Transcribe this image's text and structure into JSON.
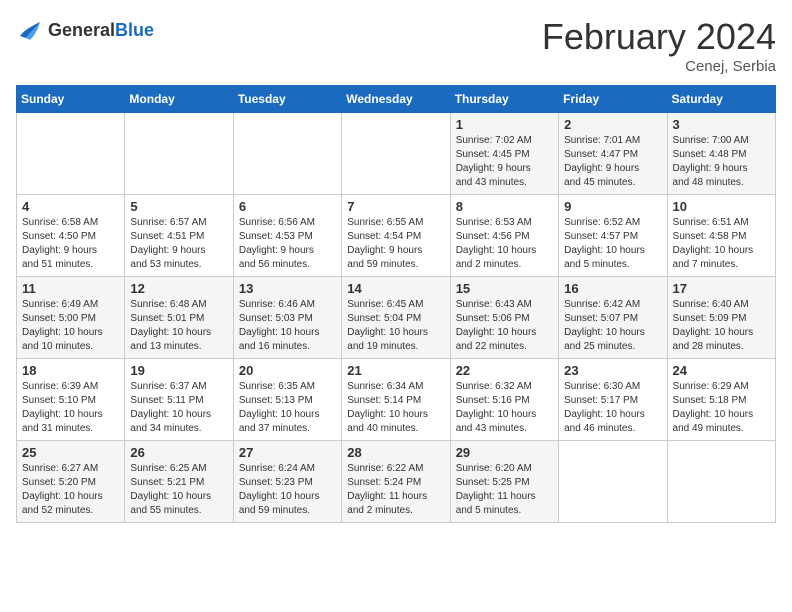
{
  "header": {
    "logo_general": "General",
    "logo_blue": "Blue",
    "title": "February 2024",
    "location": "Cenej, Serbia"
  },
  "weekdays": [
    "Sunday",
    "Monday",
    "Tuesday",
    "Wednesday",
    "Thursday",
    "Friday",
    "Saturday"
  ],
  "weeks": [
    [
      {
        "day": "",
        "info": ""
      },
      {
        "day": "",
        "info": ""
      },
      {
        "day": "",
        "info": ""
      },
      {
        "day": "",
        "info": ""
      },
      {
        "day": "1",
        "info": "Sunrise: 7:02 AM\nSunset: 4:45 PM\nDaylight: 9 hours\nand 43 minutes."
      },
      {
        "day": "2",
        "info": "Sunrise: 7:01 AM\nSunset: 4:47 PM\nDaylight: 9 hours\nand 45 minutes."
      },
      {
        "day": "3",
        "info": "Sunrise: 7:00 AM\nSunset: 4:48 PM\nDaylight: 9 hours\nand 48 minutes."
      }
    ],
    [
      {
        "day": "4",
        "info": "Sunrise: 6:58 AM\nSunset: 4:50 PM\nDaylight: 9 hours\nand 51 minutes."
      },
      {
        "day": "5",
        "info": "Sunrise: 6:57 AM\nSunset: 4:51 PM\nDaylight: 9 hours\nand 53 minutes."
      },
      {
        "day": "6",
        "info": "Sunrise: 6:56 AM\nSunset: 4:53 PM\nDaylight: 9 hours\nand 56 minutes."
      },
      {
        "day": "7",
        "info": "Sunrise: 6:55 AM\nSunset: 4:54 PM\nDaylight: 9 hours\nand 59 minutes."
      },
      {
        "day": "8",
        "info": "Sunrise: 6:53 AM\nSunset: 4:56 PM\nDaylight: 10 hours\nand 2 minutes."
      },
      {
        "day": "9",
        "info": "Sunrise: 6:52 AM\nSunset: 4:57 PM\nDaylight: 10 hours\nand 5 minutes."
      },
      {
        "day": "10",
        "info": "Sunrise: 6:51 AM\nSunset: 4:58 PM\nDaylight: 10 hours\nand 7 minutes."
      }
    ],
    [
      {
        "day": "11",
        "info": "Sunrise: 6:49 AM\nSunset: 5:00 PM\nDaylight: 10 hours\nand 10 minutes."
      },
      {
        "day": "12",
        "info": "Sunrise: 6:48 AM\nSunset: 5:01 PM\nDaylight: 10 hours\nand 13 minutes."
      },
      {
        "day": "13",
        "info": "Sunrise: 6:46 AM\nSunset: 5:03 PM\nDaylight: 10 hours\nand 16 minutes."
      },
      {
        "day": "14",
        "info": "Sunrise: 6:45 AM\nSunset: 5:04 PM\nDaylight: 10 hours\nand 19 minutes."
      },
      {
        "day": "15",
        "info": "Sunrise: 6:43 AM\nSunset: 5:06 PM\nDaylight: 10 hours\nand 22 minutes."
      },
      {
        "day": "16",
        "info": "Sunrise: 6:42 AM\nSunset: 5:07 PM\nDaylight: 10 hours\nand 25 minutes."
      },
      {
        "day": "17",
        "info": "Sunrise: 6:40 AM\nSunset: 5:09 PM\nDaylight: 10 hours\nand 28 minutes."
      }
    ],
    [
      {
        "day": "18",
        "info": "Sunrise: 6:39 AM\nSunset: 5:10 PM\nDaylight: 10 hours\nand 31 minutes."
      },
      {
        "day": "19",
        "info": "Sunrise: 6:37 AM\nSunset: 5:11 PM\nDaylight: 10 hours\nand 34 minutes."
      },
      {
        "day": "20",
        "info": "Sunrise: 6:35 AM\nSunset: 5:13 PM\nDaylight: 10 hours\nand 37 minutes."
      },
      {
        "day": "21",
        "info": "Sunrise: 6:34 AM\nSunset: 5:14 PM\nDaylight: 10 hours\nand 40 minutes."
      },
      {
        "day": "22",
        "info": "Sunrise: 6:32 AM\nSunset: 5:16 PM\nDaylight: 10 hours\nand 43 minutes."
      },
      {
        "day": "23",
        "info": "Sunrise: 6:30 AM\nSunset: 5:17 PM\nDaylight: 10 hours\nand 46 minutes."
      },
      {
        "day": "24",
        "info": "Sunrise: 6:29 AM\nSunset: 5:18 PM\nDaylight: 10 hours\nand 49 minutes."
      }
    ],
    [
      {
        "day": "25",
        "info": "Sunrise: 6:27 AM\nSunset: 5:20 PM\nDaylight: 10 hours\nand 52 minutes."
      },
      {
        "day": "26",
        "info": "Sunrise: 6:25 AM\nSunset: 5:21 PM\nDaylight: 10 hours\nand 55 minutes."
      },
      {
        "day": "27",
        "info": "Sunrise: 6:24 AM\nSunset: 5:23 PM\nDaylight: 10 hours\nand 59 minutes."
      },
      {
        "day": "28",
        "info": "Sunrise: 6:22 AM\nSunset: 5:24 PM\nDaylight: 11 hours\nand 2 minutes."
      },
      {
        "day": "29",
        "info": "Sunrise: 6:20 AM\nSunset: 5:25 PM\nDaylight: 11 hours\nand 5 minutes."
      },
      {
        "day": "",
        "info": ""
      },
      {
        "day": "",
        "info": ""
      }
    ]
  ]
}
